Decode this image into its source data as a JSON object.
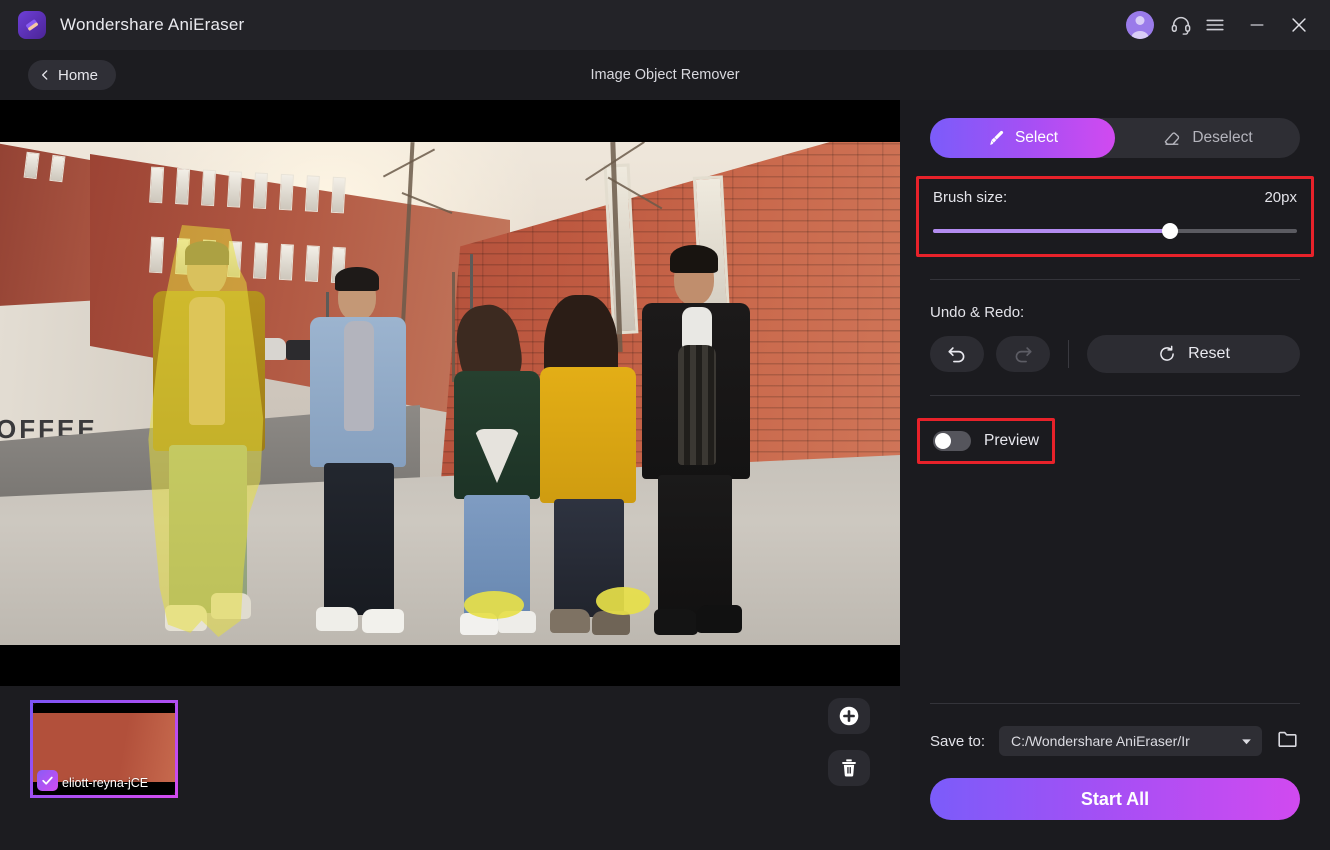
{
  "titlebar": {
    "app_name": "Wondershare AniEraser",
    "logo_icon": "eraser-logo-icon",
    "avatar_icon": "user-avatar",
    "support_icon": "headset-icon",
    "menu_icon": "hamburger-menu-icon",
    "minimize_icon": "minimize-icon",
    "close_icon": "close-icon"
  },
  "subheader": {
    "home_label": "Home",
    "back_icon": "chevron-left-icon",
    "page_title": "Image Object Remover"
  },
  "tools": {
    "select_label": "Select",
    "select_icon": "brush-icon",
    "deselect_label": "Deselect",
    "deselect_icon": "eraser-icon",
    "active_tool": "Select"
  },
  "brush": {
    "label": "Brush size:",
    "value": "20px",
    "percent": 65,
    "fill_color": "#b38cf0",
    "track_color": "#5b5b61"
  },
  "history": {
    "label": "Undo & Redo:",
    "undo_icon": "undo-icon",
    "redo_icon": "redo-icon",
    "reset_label": "Reset",
    "reset_icon": "reset-icon"
  },
  "preview": {
    "label": "Preview",
    "enabled": false
  },
  "save": {
    "label": "Save to:",
    "path": "C:/Wondershare AniEraser/Ir",
    "dropdown_icon": "chevron-down-icon",
    "folder_icon": "folder-icon",
    "start_label": "Start All"
  },
  "filmstrip": {
    "thumbnail_name": "eliott-reyna-jCE",
    "checked": true,
    "check_icon": "check-icon",
    "add_label": "add-image",
    "add_icon": "plus-circle-icon",
    "delete_label": "delete-image",
    "delete_icon": "trash-icon"
  },
  "canvas": {
    "alt": "Five young people walking on a city sidewalk beside a red brick building; the leftmost person and two sidewalk spots are covered with a yellow selection mask.",
    "coffee_sign": "OFFEE",
    "mask_color": "#e8e13c",
    "accent_start": "#7b5cfa",
    "accent_end": "#d14af0",
    "highlight_box_color": "#e8222a"
  }
}
